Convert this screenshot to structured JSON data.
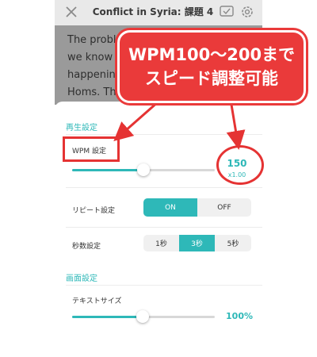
{
  "topbar": {
    "title": "Conflict in Syria: 課題 4",
    "close_icon": "close-icon",
    "check_icon": "checkbox-icon",
    "settings_icon": "gear-icon"
  },
  "article": {
    "lines": [
      "The proble",
      "we know i",
      "happening",
      "Homs. The"
    ]
  },
  "playback": {
    "section_title": "再生設定",
    "wpm_label": "WPM 設定",
    "wpm_value": "150",
    "wpm_multiplier": "x1.00",
    "wpm_slider_level": 0.5,
    "repeat_label": "リピート設定",
    "repeat_options": [
      "ON",
      "OFF"
    ],
    "repeat_selected": "ON",
    "seconds_label": "秒数設定",
    "seconds_options": [
      "1秒",
      "3秒",
      "5秒"
    ],
    "seconds_selected": "3秒"
  },
  "display": {
    "section_title": "画面設定",
    "text_size_label": "テキストサイズ",
    "text_size_value": "100%",
    "text_size_slider_level": 0.5
  },
  "annotation": {
    "line1": "WPM100〜200まで",
    "line2": "スピード調整可能",
    "color": "#ea3a3a"
  },
  "colors": {
    "accent": "#2eb8b8",
    "highlight": "#e53333"
  }
}
